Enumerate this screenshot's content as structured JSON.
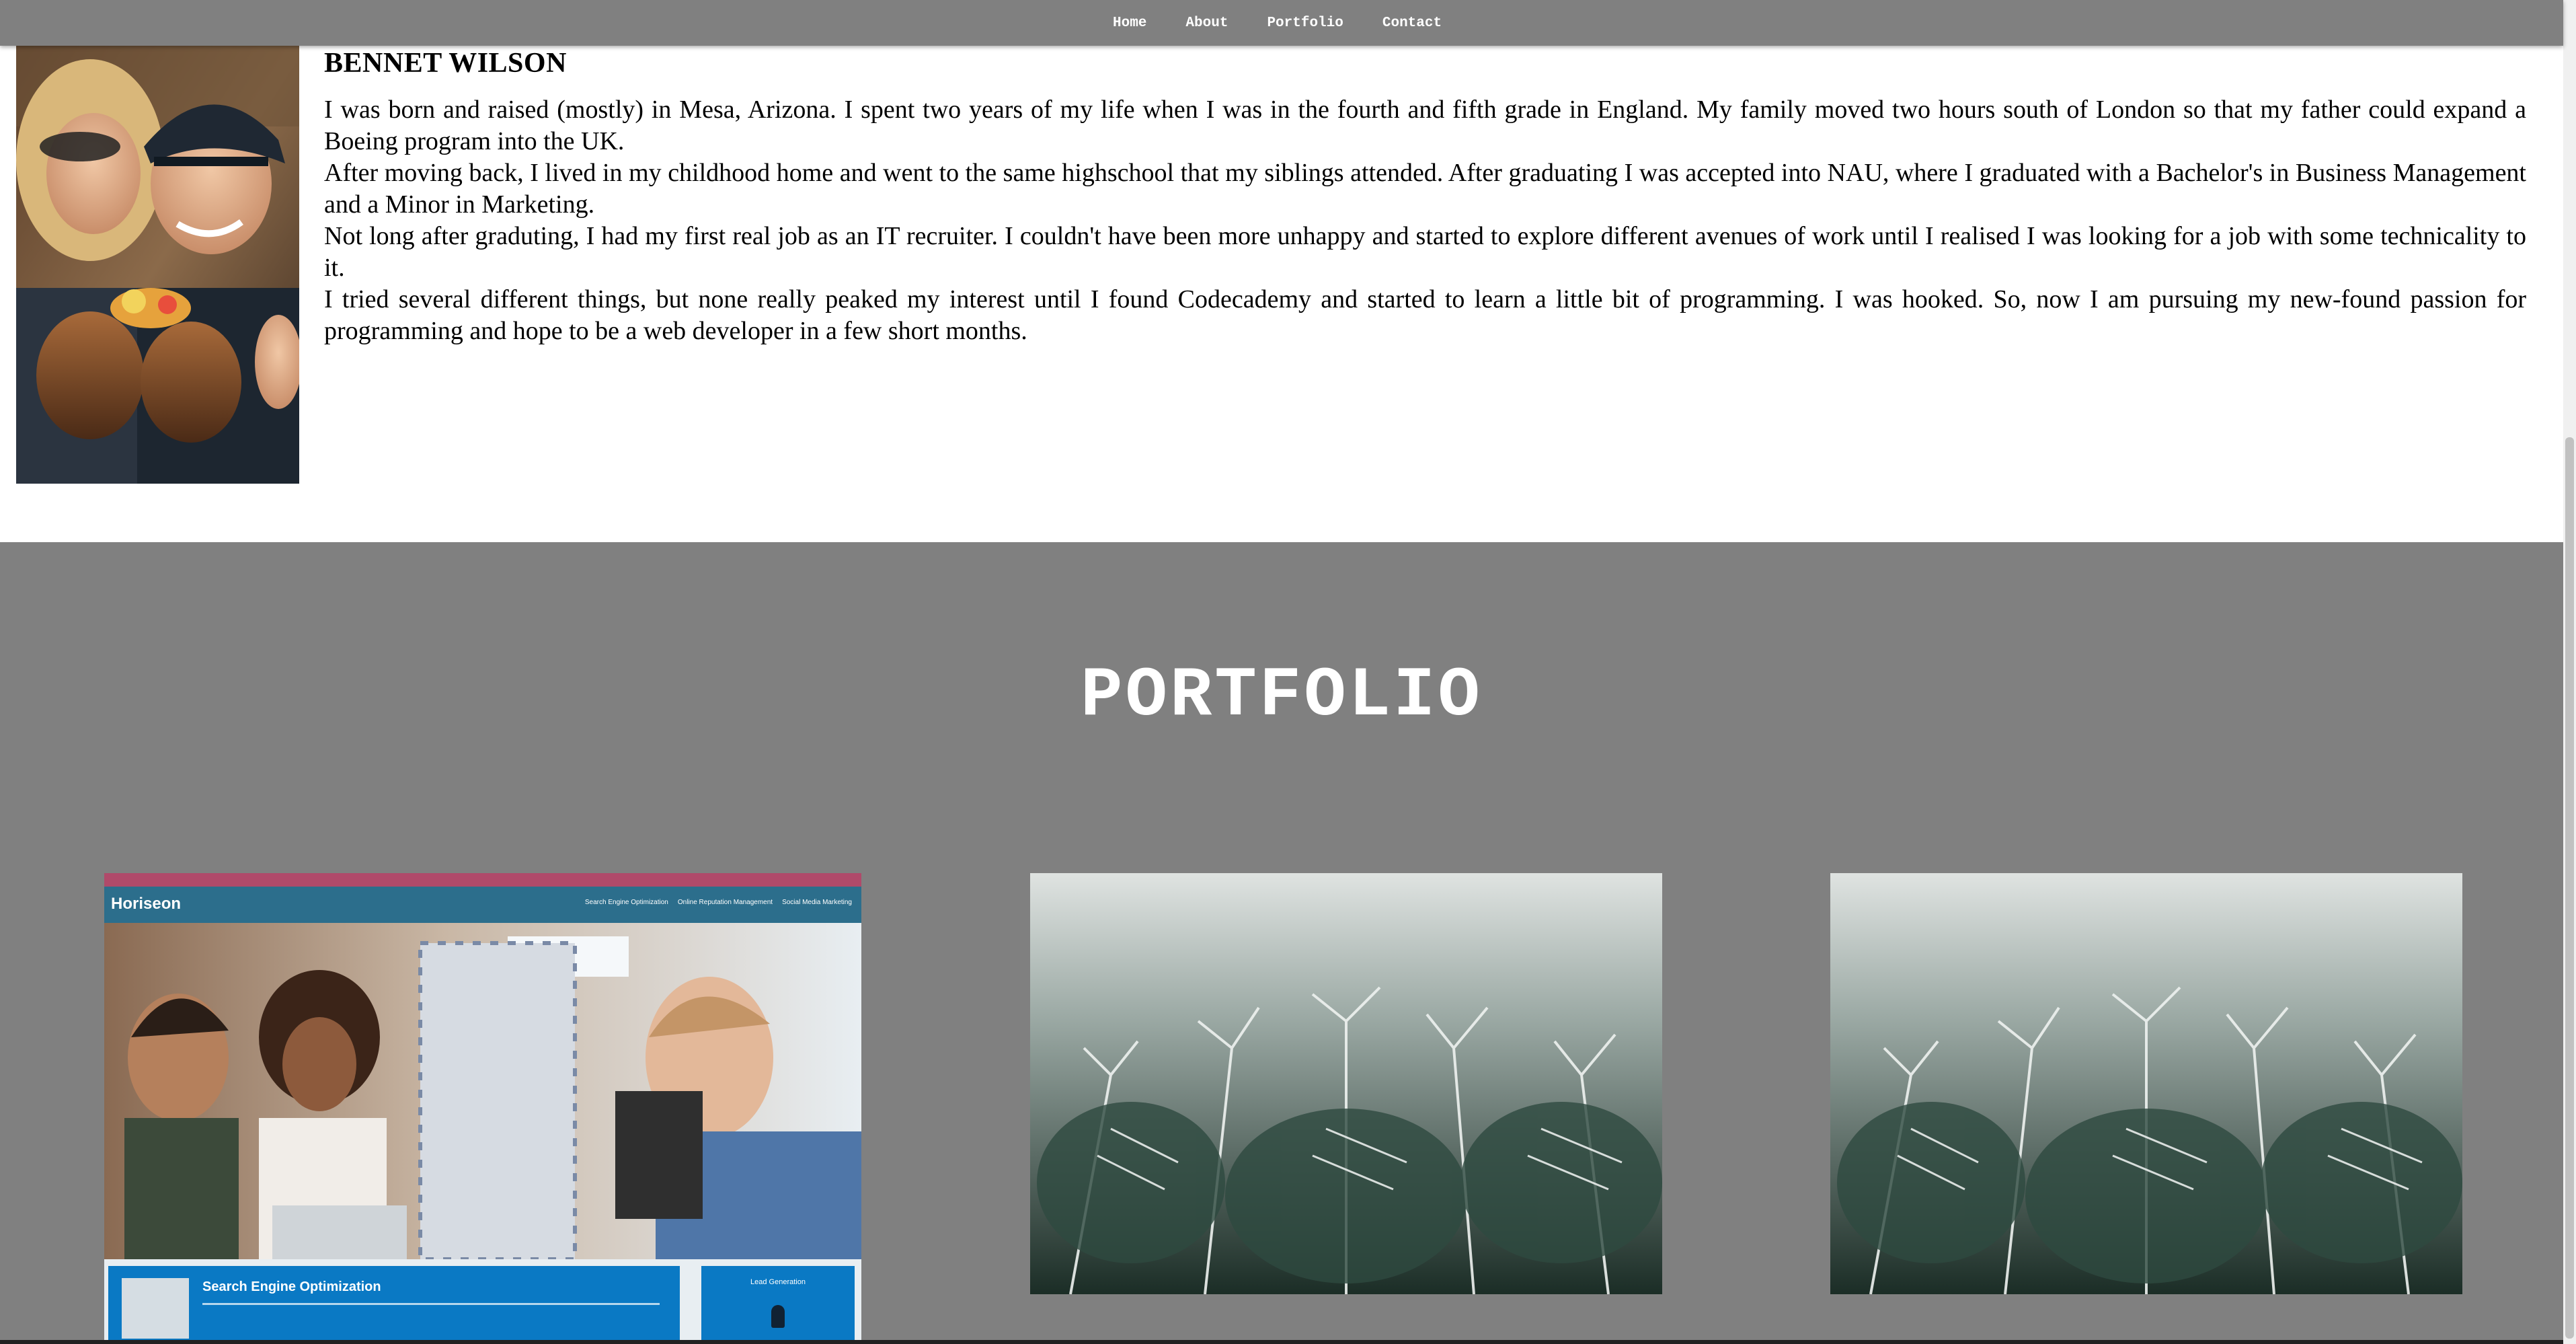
{
  "nav": {
    "links": [
      "Home",
      "About",
      "Portfolio",
      "Contact"
    ]
  },
  "about": {
    "name": "BENNET WILSON",
    "paragraphs": [
      "I was born and raised (mostly) in Mesa, Arizona. I spent two years of my life when I was in the fourth and fifth grade in England. My family moved two hours south of London so that my father could expand a Boeing program into the UK.",
      "After moving back, I lived in my childhood home and went to the same highschool that my siblings attended. After graduating I was accepted into NAU, where I graduated with a Bachelor's in Business Management and a Minor in Marketing.",
      "Not long after graduting, I had my first real job as an IT recruiter. I couldn't have been more unhappy and started to explore different avenues of work until I realised I was looking for a job with some technicality to it.",
      "I tried several different things, but none really peaked my interest until I found Codecademy and started to learn a little bit of programming. I was hooked. So, now I am pursuing my new-found passion for programming and hope to be a web developer in a few short months."
    ]
  },
  "portfolio": {
    "title": "PORTFOLIO",
    "projects": [
      {
        "logo": "Horiseon",
        "nav": [
          "Search Engine Optimization",
          "Online Reputation Management",
          "Social Media Marketing"
        ],
        "feature_title": "Search Engine Optimization",
        "side_title": "Lead Generation"
      }
    ]
  },
  "colors": {
    "nav_bg": "#808080",
    "portfolio_bg": "#808080",
    "horiseon_header": "#2c6e8c",
    "horiseon_feature": "#0a79c4"
  }
}
